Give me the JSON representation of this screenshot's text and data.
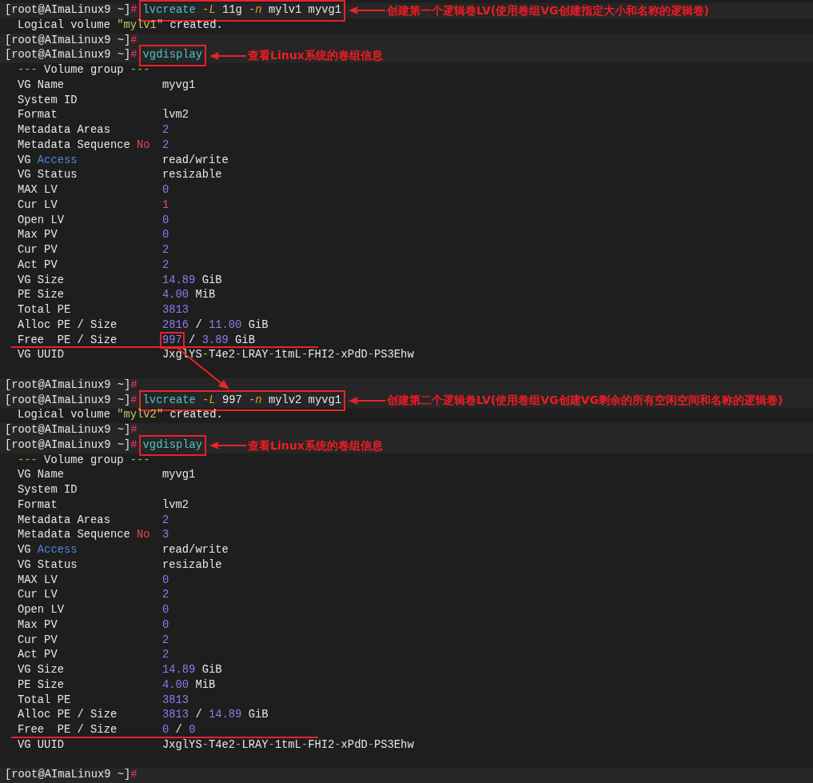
{
  "lines": [
    {
      "kind": "prompt",
      "prompt": "[root@AImaLinux9 ~]",
      "symbol": "#",
      "boxed": true,
      "command": [
        {
          "text": "lvcreate ",
          "kind": "cmd"
        },
        {
          "text": "-L",
          "kind": "flag"
        },
        {
          "text": " 11g ",
          "kind": "plain"
        },
        {
          "text": "-n",
          "kind": "flag"
        },
        {
          "text": " mylv1 myvg1",
          "kind": "plain"
        }
      ],
      "note": "创建第一个逻辑卷LV(使用卷组VG创建指定大小和名称的逻辑卷)"
    },
    {
      "kind": "output",
      "parts": [
        {
          "text": "Logical volume ",
          "kind": "plain"
        },
        {
          "text": "\"mylv1\"",
          "kind": "str"
        },
        {
          "text": " created.",
          "kind": "plain"
        }
      ]
    },
    {
      "kind": "prompt",
      "prompt": "[root@AImaLinux9 ~]",
      "symbol": "#"
    },
    {
      "kind": "prompt",
      "prompt": "[root@AImaLinux9 ~]",
      "symbol": "#",
      "boxed": true,
      "command": [
        {
          "text": "vgdisplay",
          "kind": "cmd"
        }
      ],
      "note": "查看Linux系统的卷组信息"
    },
    {
      "kind": "output",
      "parts": [
        {
          "text": "---",
          "kind": "dash"
        },
        {
          "text": " Volume group ",
          "kind": "plain"
        },
        {
          "text": "---",
          "kind": "dash"
        }
      ]
    },
    {
      "kind": "field",
      "label": [
        {
          "text": "VG Name",
          "kind": "plain"
        }
      ],
      "value": [
        {
          "text": "myvg1",
          "kind": "plain"
        }
      ]
    },
    {
      "kind": "field",
      "label": [
        {
          "text": "System ID",
          "kind": "plain"
        }
      ]
    },
    {
      "kind": "field",
      "label": [
        {
          "text": "Format",
          "kind": "plain"
        }
      ],
      "value": [
        {
          "text": "lvm2",
          "kind": "plain"
        }
      ]
    },
    {
      "kind": "field",
      "label": [
        {
          "text": "Metadata Areas",
          "kind": "plain"
        }
      ],
      "value": [
        {
          "text": "2",
          "kind": "num"
        }
      ]
    },
    {
      "kind": "field",
      "label": [
        {
          "text": "Metadata Sequence ",
          "kind": "plain"
        },
        {
          "text": "No",
          "kind": "key"
        }
      ],
      "value": [
        {
          "text": "2",
          "kind": "num"
        }
      ]
    },
    {
      "kind": "field",
      "label": [
        {
          "text": "VG ",
          "kind": "plain"
        },
        {
          "text": "Access",
          "kind": "blue"
        }
      ],
      "value": [
        {
          "text": "read/write",
          "kind": "plain"
        }
      ]
    },
    {
      "kind": "field",
      "label": [
        {
          "text": "VG Status",
          "kind": "plain"
        }
      ],
      "value": [
        {
          "text": "resizable",
          "kind": "plain"
        }
      ]
    },
    {
      "kind": "field",
      "label": [
        {
          "text": "MAX LV",
          "kind": "plain"
        }
      ],
      "value": [
        {
          "text": "0",
          "kind": "num"
        }
      ]
    },
    {
      "kind": "field",
      "label": [
        {
          "text": "Cur LV",
          "kind": "plain"
        }
      ],
      "value": [
        {
          "text": "1",
          "kind": "pink"
        }
      ]
    },
    {
      "kind": "field",
      "label": [
        {
          "text": "Open LV",
          "kind": "plain"
        }
      ],
      "value": [
        {
          "text": "0",
          "kind": "num"
        }
      ]
    },
    {
      "kind": "field",
      "label": [
        {
          "text": "Max PV",
          "kind": "plain"
        }
      ],
      "value": [
        {
          "text": "0",
          "kind": "num"
        }
      ]
    },
    {
      "kind": "field",
      "label": [
        {
          "text": "Cur PV",
          "kind": "plain"
        }
      ],
      "value": [
        {
          "text": "2",
          "kind": "num"
        }
      ]
    },
    {
      "kind": "field",
      "label": [
        {
          "text": "Act PV",
          "kind": "plain"
        }
      ],
      "value": [
        {
          "text": "2",
          "kind": "num"
        }
      ]
    },
    {
      "kind": "field",
      "label": [
        {
          "text": "VG Size",
          "kind": "plain"
        }
      ],
      "value": [
        {
          "text": "14.89",
          "kind": "num"
        },
        {
          "text": " GiB",
          "kind": "plain"
        }
      ]
    },
    {
      "kind": "field",
      "label": [
        {
          "text": "PE Size",
          "kind": "plain"
        }
      ],
      "value": [
        {
          "text": "4.00",
          "kind": "num"
        },
        {
          "text": " MiB",
          "kind": "plain"
        }
      ]
    },
    {
      "kind": "field",
      "label": [
        {
          "text": "Total PE",
          "kind": "plain"
        }
      ],
      "value": [
        {
          "text": "3813",
          "kind": "num"
        }
      ]
    },
    {
      "kind": "field",
      "label": [
        {
          "text": "Alloc PE / Size",
          "kind": "plain"
        }
      ],
      "value": [
        {
          "text": "2816",
          "kind": "num"
        },
        {
          "text": " / ",
          "kind": "plain"
        },
        {
          "text": "11.00",
          "kind": "num"
        },
        {
          "text": " GiB",
          "kind": "plain"
        }
      ]
    },
    {
      "kind": "field",
      "underlined": true,
      "label": [
        {
          "text": "Free  PE / Size",
          "kind": "plain"
        }
      ],
      "value": [
        {
          "text": "997",
          "kind": "num",
          "boxed": true
        },
        {
          "text": " / ",
          "kind": "plain"
        },
        {
          "text": "3.89",
          "kind": "num"
        },
        {
          "text": " GiB",
          "kind": "plain"
        }
      ]
    },
    {
      "kind": "field",
      "label": [
        {
          "text": "VG UUID",
          "kind": "plain"
        }
      ],
      "value": [
        {
          "text": "JxglYS",
          "kind": "plain"
        },
        {
          "text": "-",
          "kind": "dash"
        },
        {
          "text": "T4e2",
          "kind": "plain"
        },
        {
          "text": "-",
          "kind": "dash"
        },
        {
          "text": "LRAY",
          "kind": "plain"
        },
        {
          "text": "-",
          "kind": "dash"
        },
        {
          "text": "1tmL",
          "kind": "plain"
        },
        {
          "text": "-",
          "kind": "dash"
        },
        {
          "text": "FHI2",
          "kind": "plain"
        },
        {
          "text": "-",
          "kind": "dash"
        },
        {
          "text": "xPdD",
          "kind": "plain"
        },
        {
          "text": "-",
          "kind": "dash"
        },
        {
          "text": "PS3Ehw",
          "kind": "plain"
        }
      ]
    },
    {
      "kind": "blank"
    },
    {
      "kind": "prompt",
      "prompt": "[root@AImaLinux9 ~]",
      "symbol": "#"
    },
    {
      "kind": "prompt",
      "prompt": "[root@AImaLinux9 ~]",
      "symbol": "#",
      "boxed": true,
      "command": [
        {
          "text": "lvcreate ",
          "kind": "cmd"
        },
        {
          "text": "-L",
          "kind": "flag"
        },
        {
          "text": " 997 ",
          "kind": "plain"
        },
        {
          "text": "-n",
          "kind": "flag"
        },
        {
          "text": " mylv2 myvg1",
          "kind": "plain"
        }
      ],
      "note": "创建第二个逻辑卷LV(使用卷组VG创建VG剩余的所有空闲空间和名称的逻辑卷)"
    },
    {
      "kind": "output",
      "parts": [
        {
          "text": "Logical volume ",
          "kind": "plain"
        },
        {
          "text": "\"mylv2\"",
          "kind": "str"
        },
        {
          "text": " created.",
          "kind": "plain"
        }
      ]
    },
    {
      "kind": "prompt",
      "prompt": "[root@AImaLinux9 ~]",
      "symbol": "#"
    },
    {
      "kind": "prompt",
      "prompt": "[root@AImaLinux9 ~]",
      "symbol": "#",
      "boxed": true,
      "command": [
        {
          "text": "vgdisplay",
          "kind": "cmd"
        }
      ],
      "note": "查看Linux系统的卷组信息"
    },
    {
      "kind": "output",
      "parts": [
        {
          "text": "---",
          "kind": "dash"
        },
        {
          "text": " Volume group ",
          "kind": "plain"
        },
        {
          "text": "---",
          "kind": "dash"
        }
      ]
    },
    {
      "kind": "field",
      "label": [
        {
          "text": "VG Name",
          "kind": "plain"
        }
      ],
      "value": [
        {
          "text": "myvg1",
          "kind": "plain"
        }
      ]
    },
    {
      "kind": "field",
      "label": [
        {
          "text": "System ID",
          "kind": "plain"
        }
      ]
    },
    {
      "kind": "field",
      "label": [
        {
          "text": "Format",
          "kind": "plain"
        }
      ],
      "value": [
        {
          "text": "lvm2",
          "kind": "plain"
        }
      ]
    },
    {
      "kind": "field",
      "label": [
        {
          "text": "Metadata Areas",
          "kind": "plain"
        }
      ],
      "value": [
        {
          "text": "2",
          "kind": "num"
        }
      ]
    },
    {
      "kind": "field",
      "label": [
        {
          "text": "Metadata Sequence ",
          "kind": "plain"
        },
        {
          "text": "No",
          "kind": "key"
        }
      ],
      "value": [
        {
          "text": "3",
          "kind": "num"
        }
      ]
    },
    {
      "kind": "field",
      "label": [
        {
          "text": "VG ",
          "kind": "plain"
        },
        {
          "text": "Access",
          "kind": "blue"
        }
      ],
      "value": [
        {
          "text": "read/write",
          "kind": "plain"
        }
      ]
    },
    {
      "kind": "field",
      "label": [
        {
          "text": "VG Status",
          "kind": "plain"
        }
      ],
      "value": [
        {
          "text": "resizable",
          "kind": "plain"
        }
      ]
    },
    {
      "kind": "field",
      "label": [
        {
          "text": "MAX LV",
          "kind": "plain"
        }
      ],
      "value": [
        {
          "text": "0",
          "kind": "num"
        }
      ]
    },
    {
      "kind": "field",
      "label": [
        {
          "text": "Cur LV",
          "kind": "plain"
        }
      ],
      "value": [
        {
          "text": "2",
          "kind": "num"
        }
      ]
    },
    {
      "kind": "field",
      "label": [
        {
          "text": "Open LV",
          "kind": "plain"
        }
      ],
      "value": [
        {
          "text": "0",
          "kind": "num"
        }
      ]
    },
    {
      "kind": "field",
      "label": [
        {
          "text": "Max PV",
          "kind": "plain"
        }
      ],
      "value": [
        {
          "text": "0",
          "kind": "num"
        }
      ]
    },
    {
      "kind": "field",
      "label": [
        {
          "text": "Cur PV",
          "kind": "plain"
        }
      ],
      "value": [
        {
          "text": "2",
          "kind": "num"
        }
      ]
    },
    {
      "kind": "field",
      "label": [
        {
          "text": "Act PV",
          "kind": "plain"
        }
      ],
      "value": [
        {
          "text": "2",
          "kind": "num"
        }
      ]
    },
    {
      "kind": "field",
      "label": [
        {
          "text": "VG Size",
          "kind": "plain"
        }
      ],
      "value": [
        {
          "text": "14.89",
          "kind": "num"
        },
        {
          "text": " GiB",
          "kind": "plain"
        }
      ]
    },
    {
      "kind": "field",
      "label": [
        {
          "text": "PE Size",
          "kind": "plain"
        }
      ],
      "value": [
        {
          "text": "4.00",
          "kind": "num"
        },
        {
          "text": " MiB",
          "kind": "plain"
        }
      ]
    },
    {
      "kind": "field",
      "label": [
        {
          "text": "Total PE",
          "kind": "plain"
        }
      ],
      "value": [
        {
          "text": "3813",
          "kind": "num"
        }
      ]
    },
    {
      "kind": "field",
      "label": [
        {
          "text": "Alloc PE / Size",
          "kind": "plain"
        }
      ],
      "value": [
        {
          "text": "3813",
          "kind": "num"
        },
        {
          "text": " / ",
          "kind": "plain"
        },
        {
          "text": "14.89",
          "kind": "num"
        },
        {
          "text": " GiB",
          "kind": "plain"
        }
      ]
    },
    {
      "kind": "field",
      "underlined": true,
      "label": [
        {
          "text": "Free  PE / Size",
          "kind": "plain"
        }
      ],
      "value": [
        {
          "text": "0",
          "kind": "num"
        },
        {
          "text": " / ",
          "kind": "plain"
        },
        {
          "text": "0",
          "kind": "num"
        }
      ]
    },
    {
      "kind": "field",
      "label": [
        {
          "text": "VG UUID",
          "kind": "plain"
        }
      ],
      "value": [
        {
          "text": "JxglYS",
          "kind": "plain"
        },
        {
          "text": "-",
          "kind": "dash"
        },
        {
          "text": "T4e2",
          "kind": "plain"
        },
        {
          "text": "-",
          "kind": "dash"
        },
        {
          "text": "LRAY",
          "kind": "plain"
        },
        {
          "text": "-",
          "kind": "dash"
        },
        {
          "text": "1tmL",
          "kind": "plain"
        },
        {
          "text": "-",
          "kind": "dash"
        },
        {
          "text": "FHI2",
          "kind": "plain"
        },
        {
          "text": "-",
          "kind": "dash"
        },
        {
          "text": "xPdD",
          "kind": "plain"
        },
        {
          "text": "-",
          "kind": "dash"
        },
        {
          "text": "PS3Ehw",
          "kind": "plain"
        }
      ]
    },
    {
      "kind": "blank"
    },
    {
      "kind": "prompt",
      "prompt": "[root@AImaLinux9 ~]",
      "symbol": "#"
    }
  ]
}
